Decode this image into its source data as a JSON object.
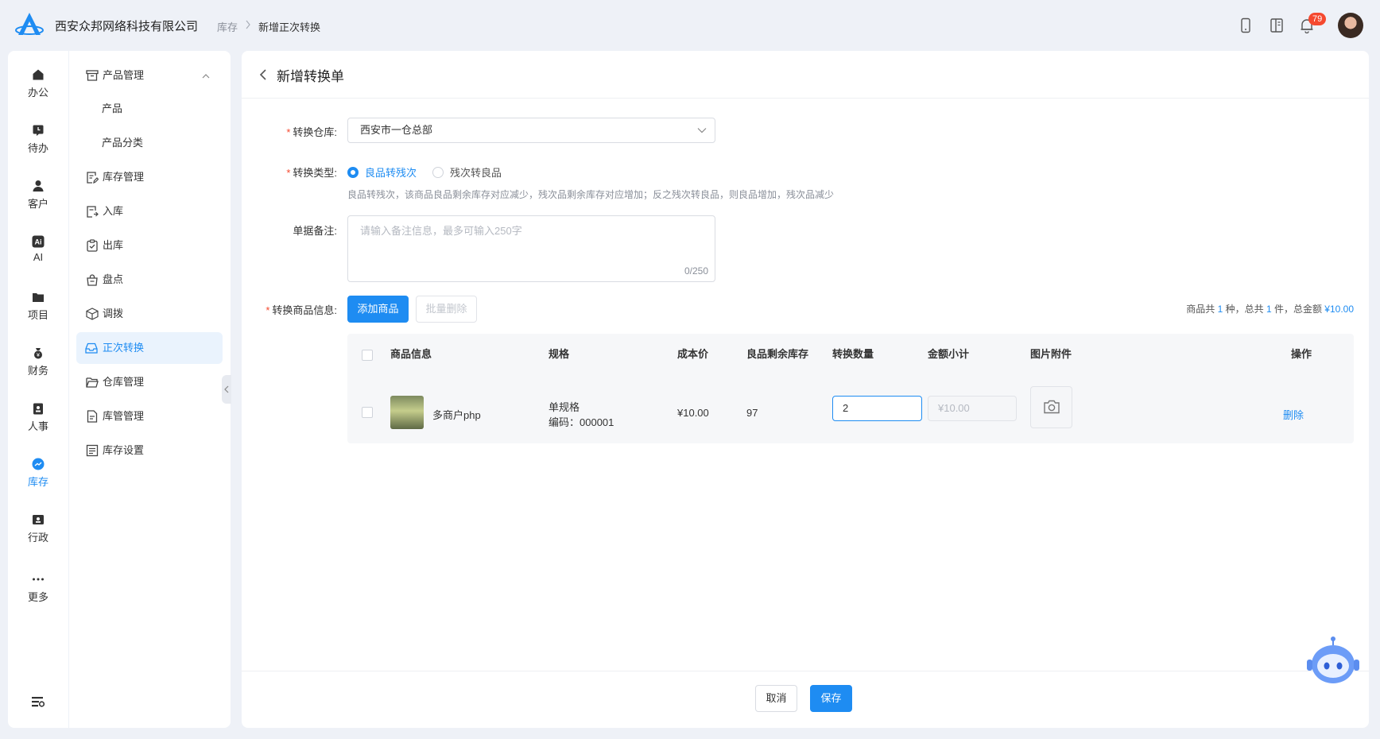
{
  "app": {
    "company": "西安众邦网络科技有限公司",
    "logo_icon": "logo-icon"
  },
  "breadcrumb": [
    "库存",
    "新增正次转换"
  ],
  "topbar": {
    "notification_count": "79",
    "icons": [
      "phone-icon",
      "book-icon",
      "bell-icon",
      "avatar"
    ]
  },
  "rail": {
    "items": [
      {
        "label": "办公",
        "icon": "home-icon"
      },
      {
        "label": "待办",
        "icon": "clock-icon"
      },
      {
        "label": "客户",
        "icon": "user-icon"
      },
      {
        "label": "AI",
        "icon": "ai-icon"
      },
      {
        "label": "项目",
        "icon": "folder-icon"
      },
      {
        "label": "财务",
        "icon": "money-bag-icon"
      },
      {
        "label": "人事",
        "icon": "badge-icon"
      },
      {
        "label": "库存",
        "icon": "chart-icon",
        "active": true
      },
      {
        "label": "行政",
        "icon": "id-card-icon"
      },
      {
        "label": "更多",
        "icon": "more-icon"
      }
    ],
    "bottom_icon": "settings-list-icon"
  },
  "submenu": {
    "items": [
      {
        "label": "产品管理",
        "icon": "archive-icon",
        "expanded": true
      },
      {
        "label": "产品",
        "child": true
      },
      {
        "label": "产品分类",
        "child": true
      },
      {
        "label": "库存管理",
        "icon": "doc-edit-icon"
      },
      {
        "label": "入库",
        "icon": "doc-in-icon"
      },
      {
        "label": "出库",
        "icon": "clipboard-check-icon"
      },
      {
        "label": "盘点",
        "icon": "bag-icon"
      },
      {
        "label": "调拨",
        "icon": "cube-icon"
      },
      {
        "label": "正次转换",
        "icon": "inbox-icon",
        "active": true
      },
      {
        "label": "仓库管理",
        "icon": "folder-open-icon"
      },
      {
        "label": "库管管理",
        "icon": "doc-icon"
      },
      {
        "label": "库存设置",
        "icon": "doc-list-icon"
      }
    ]
  },
  "page": {
    "title": "新增转换单"
  },
  "form": {
    "warehouse": {
      "label": "转换仓库:",
      "value": "西安市一仓总部"
    },
    "type": {
      "label": "转换类型:",
      "options": [
        "良品转残次",
        "残次转良品"
      ],
      "selected": "良品转残次",
      "hint": "良品转残次，该商品良品剩余库存对应减少，残次品剩余库存对应增加；反之残次转良品，则良品增加，残次品减少"
    },
    "remark": {
      "label": "单据备注:",
      "placeholder": "请输入备注信息，最多可输入250字",
      "count": "0/250"
    },
    "goods": {
      "label": "转换商品信息:",
      "add_button": "添加商品",
      "batch_delete_button": "批量删除",
      "summary": {
        "p1": "商品共 ",
        "kinds": "1",
        "p2": " 种，总共 ",
        "pieces": "1",
        "p3": " 件，总金额 ",
        "amount": "¥10.00"
      }
    }
  },
  "table": {
    "headers": [
      "商品信息",
      "规格",
      "成本价",
      "良品剩余库存",
      "转换数量",
      "金额小计",
      "图片附件",
      "操作"
    ],
    "rows": [
      {
        "name": "多商户php",
        "spec": "单规格",
        "code": "编码：000001",
        "cost": "¥10.00",
        "stock": "97",
        "qty": "2",
        "subtotal": "¥10.00",
        "attachment_icon": "camera-icon",
        "action": "删除"
      }
    ]
  },
  "footer": {
    "cancel": "取消",
    "save": "保存"
  },
  "colors": {
    "primary": "#1e8cf2",
    "required": "#f5492f",
    "badge": "#f5492f"
  }
}
